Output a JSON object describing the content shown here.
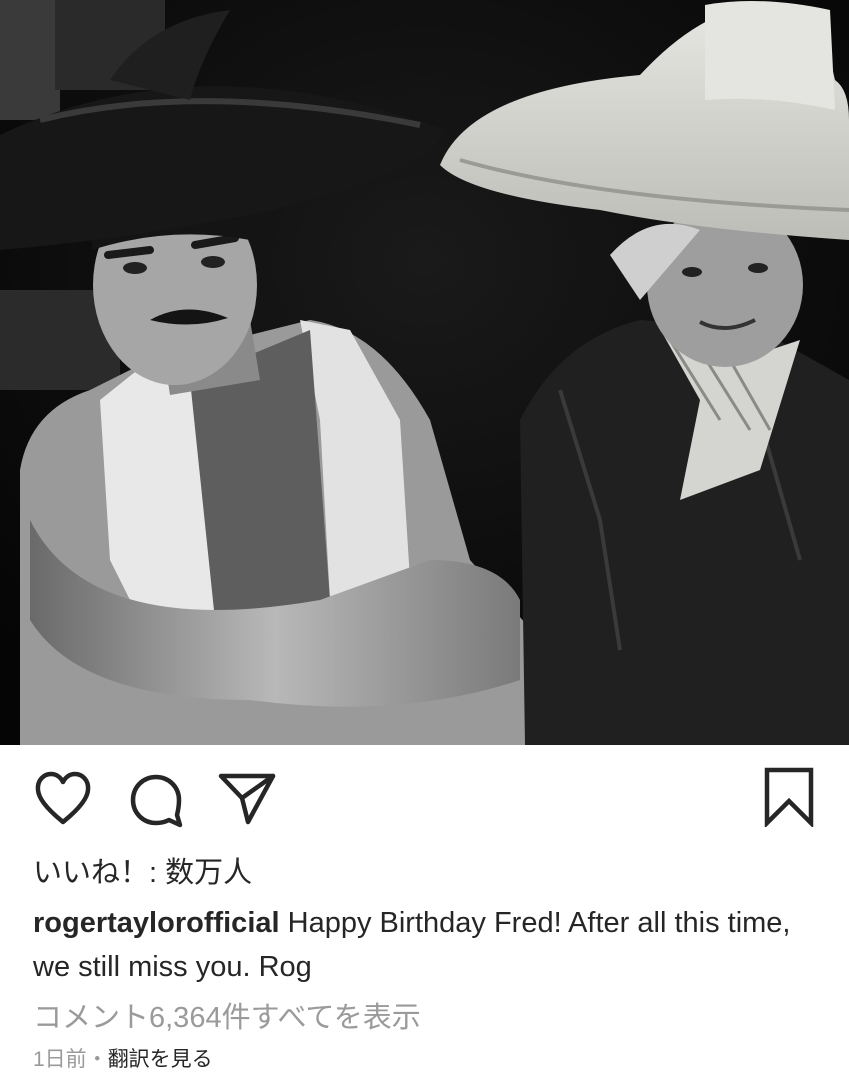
{
  "post": {
    "image": {
      "description": "black-and-white photo of two men wearing sombreros"
    },
    "actions": {
      "like_icon": "heart-outline-icon",
      "comment_icon": "comment-bubble-icon",
      "share_icon": "paper-plane-icon",
      "save_icon": "bookmark-outline-icon"
    },
    "likes_text": "いいね！: 数万人",
    "caption": {
      "username": "rogertaylorofficial",
      "text": " Happy Birthday Fred! After all this time, we still miss you. Rog"
    },
    "view_comments_text": "コメント6,364件すべてを表示",
    "meta": {
      "time": "1日前",
      "separator": "・",
      "translate": "翻訳を見る"
    }
  }
}
